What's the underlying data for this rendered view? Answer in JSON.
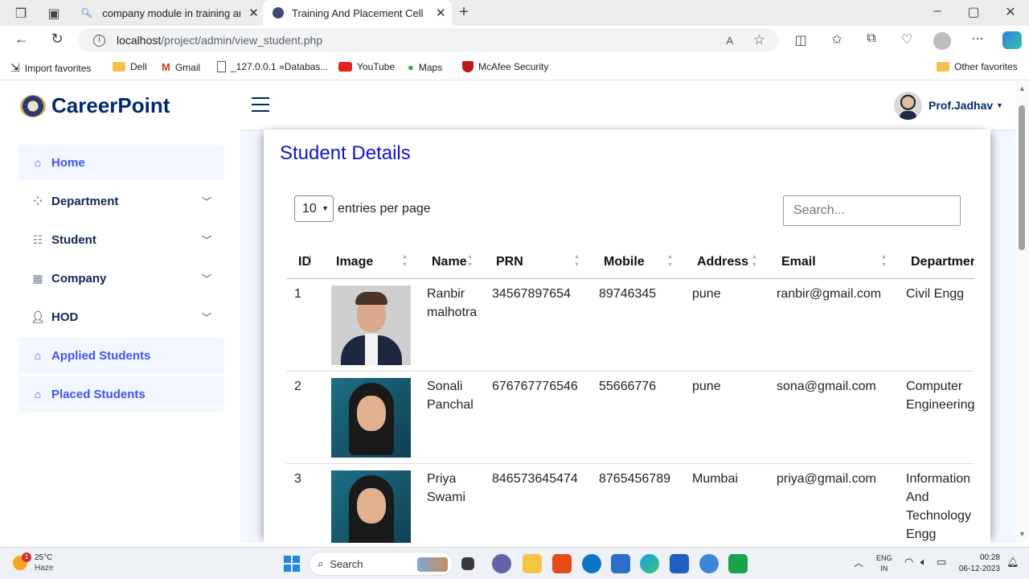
{
  "browser": {
    "tabs": [
      {
        "title": "company module in training and"
      },
      {
        "title": "Training And Placement Cell"
      }
    ],
    "url_host": "localhost",
    "url_path": "/project/admin/view_student.php",
    "favorites": [
      "Import favorites",
      "Dell",
      "Gmail",
      "_127.0.0.1 »Databas...",
      "YouTube",
      "Maps",
      "McAfee Security"
    ],
    "other_favorites": "Other favorites"
  },
  "header": {
    "brand": "CareerPoint",
    "user": "Prof.Jadhav"
  },
  "sidebar": {
    "items": [
      {
        "label": "Home"
      },
      {
        "label": "Department"
      },
      {
        "label": "Student"
      },
      {
        "label": "Company"
      },
      {
        "label": "HOD"
      },
      {
        "label": "Applied Students"
      },
      {
        "label": "Placed Students"
      }
    ]
  },
  "main": {
    "title": "Student Details",
    "entries_value": "10",
    "entries_label": "entries per page",
    "search_placeholder": "Search...",
    "columns": [
      "ID",
      "Image",
      "Name",
      "PRN",
      "Mobile",
      "Address",
      "Email",
      "Departmer"
    ],
    "rows": [
      {
        "id": "1",
        "name": [
          "Ranbir",
          "malhotra"
        ],
        "prn": "34567897654",
        "mobile": "89746345",
        "address": "pune",
        "email": "ranbir@gmail.com",
        "dept": [
          "Civil Engg"
        ]
      },
      {
        "id": "2",
        "name": [
          "Sonali",
          "Panchal"
        ],
        "prn": "676767776546",
        "mobile": "55666776",
        "address": "pune",
        "email": "sona@gmail.com",
        "dept": [
          "Computer",
          "Engineering"
        ]
      },
      {
        "id": "3",
        "name": [
          "Priya",
          "Swami"
        ],
        "prn": "846573645474",
        "mobile": "8765456789",
        "address": "Mumbai",
        "email": "priya@gmail.com",
        "dept": [
          "Information",
          "And",
          "Technology",
          "Engg"
        ]
      }
    ]
  },
  "taskbar": {
    "temp": "25°C",
    "weather": "Haze",
    "badge": "1",
    "search": "Search",
    "lang1": "ENG",
    "lang2": "IN",
    "time": "00:28",
    "date": "06-12-2023"
  }
}
